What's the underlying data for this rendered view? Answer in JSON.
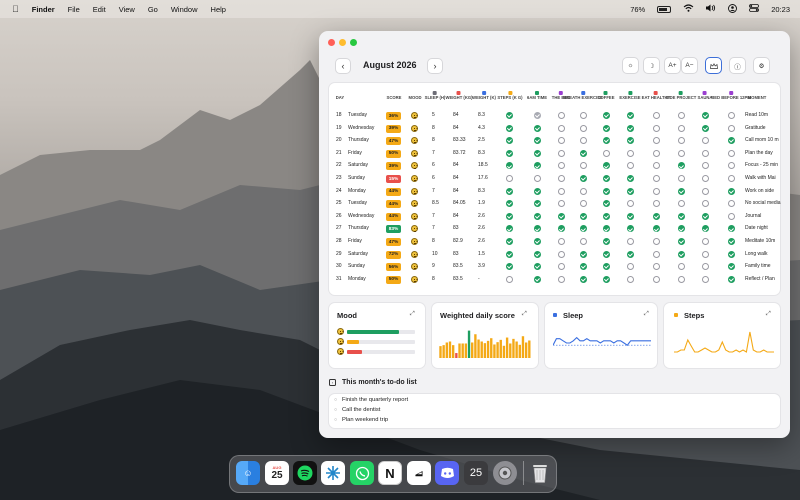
{
  "menubar": {
    "app_name": "Finder",
    "menus": [
      "File",
      "Edit",
      "View",
      "Go",
      "Window",
      "Help"
    ],
    "battery": "76%",
    "clock": "20:23"
  },
  "header": {
    "month": "August 2026",
    "prev_icon": "chevron-left-icon",
    "next_icon": "chevron-right-icon",
    "buttons": [
      "sun-icon",
      "moon-icon",
      "A+",
      "A−",
      "crown-icon",
      "info-icon",
      "gear-icon"
    ]
  },
  "columns": {
    "day": "DAY",
    "score": "SCORE",
    "mood": "MOOD",
    "sleep": "SLEEP (H)",
    "weight_kg": "WEIGHT (KG)",
    "weight_change": "WEIGHT (K)",
    "steps": "STEPS (K G)",
    "habits": [
      "6AM TIME",
      "THE BED",
      "BREATH EXERCISE",
      "COFFEE",
      "EXERCISE",
      "EAT HEALTHY",
      "SIDE PROJECT",
      "SAUNA",
      "BED BEFORE 12PM"
    ],
    "moment": "MOMENT"
  },
  "colors": {
    "sleep_dot": "#6c6c75",
    "weight_dot": "#e8504b",
    "weight2_dot": "#3a6fe0",
    "steps_dot": "#f4a916",
    "habit_dots": [
      "#1e9e60",
      "#9a3fd0",
      "#3a6fe0",
      "#1e9e60",
      "#1e9e60",
      "#e8504b",
      "#1e9e60",
      "#9a3fd0",
      "#9a3fd0"
    ],
    "score_high": "#f4b740",
    "score_mid": "#f0c33c",
    "score_low": "#e8504b",
    "score_top": "#1e9e60"
  },
  "rows": [
    {
      "day": "18",
      "weekday": "Tuesday",
      "score": "36%",
      "score_color": "#f4a916",
      "sleep": "5",
      "weight": "84",
      "delta": "8.3",
      "steps": "on",
      "habits": [
        "gray",
        "off",
        "off",
        "on",
        "on",
        "off",
        "off",
        "on",
        "off"
      ],
      "moment": "Read 10m"
    },
    {
      "day": "19",
      "weekday": "Wednesday",
      "score": "39%",
      "score_color": "#f4a916",
      "sleep": "8",
      "weight": "84",
      "delta": "4.3",
      "steps": "on",
      "habits": [
        "on",
        "off",
        "off",
        "on",
        "on",
        "off",
        "off",
        "on",
        "off"
      ],
      "moment": "Gratitude"
    },
    {
      "day": "20",
      "weekday": "Thursday",
      "score": "47%",
      "score_color": "#f4a916",
      "sleep": "8",
      "weight": "83.33",
      "delta": "2.5",
      "steps": "on",
      "habits": [
        "on",
        "off",
        "off",
        "on",
        "on",
        "off",
        "off",
        "off",
        "on"
      ],
      "moment": "Call mom 10 m"
    },
    {
      "day": "21",
      "weekday": "Friday",
      "score": "50%",
      "score_color": "#f4a916",
      "sleep": "7",
      "weight": "83.72",
      "delta": "8.3",
      "steps": "on",
      "habits": [
        "on",
        "off",
        "on",
        "off",
        "off",
        "off",
        "off",
        "off",
        "off"
      ],
      "moment": "Plan the day"
    },
    {
      "day": "22",
      "weekday": "Saturday",
      "score": "39%",
      "score_color": "#f4a916",
      "sleep": "6",
      "weight": "84",
      "delta": "18.5",
      "steps": "on",
      "habits": [
        "on",
        "off",
        "off",
        "on",
        "off",
        "off",
        "on",
        "off",
        "off"
      ],
      "moment": "Focus - 25 min"
    },
    {
      "day": "23",
      "weekday": "Sunday",
      "score": "15%",
      "score_color": "#e8504b",
      "sleep": "6",
      "weight": "84",
      "delta": "17.6",
      "steps": "off",
      "habits": [
        "off",
        "off",
        "on",
        "on",
        "on",
        "off",
        "off",
        "off",
        "off"
      ],
      "moment": "Walk with Mai"
    },
    {
      "day": "24",
      "weekday": "Monday",
      "score": "44%",
      "score_color": "#f4a916",
      "sleep": "7",
      "weight": "84",
      "delta": "8.3",
      "steps": "on",
      "habits": [
        "on",
        "off",
        "off",
        "on",
        "on",
        "off",
        "on",
        "off",
        "on"
      ],
      "moment": "Work on side"
    },
    {
      "day": "25",
      "weekday": "Tuesday",
      "score": "44%",
      "score_color": "#f4a916",
      "sleep": "8.5",
      "weight": "84.05",
      "delta": "1.9",
      "steps": "on",
      "habits": [
        "on",
        "off",
        "off",
        "on",
        "off",
        "off",
        "off",
        "off",
        "off"
      ],
      "moment": "No social media"
    },
    {
      "day": "26",
      "weekday": "Wednesday",
      "score": "44%",
      "score_color": "#f4a916",
      "sleep": "7",
      "weight": "84",
      "delta": "2.6",
      "steps": "on",
      "habits": [
        "on",
        "on",
        "on",
        "on",
        "on",
        "on",
        "on",
        "on",
        "off"
      ],
      "moment": "Journal"
    },
    {
      "day": "27",
      "weekday": "Thursday",
      "score": "83%",
      "score_color": "#1e9e60",
      "sleep": "7",
      "weight": "83",
      "delta": "2.6",
      "steps": "on",
      "habits": [
        "on",
        "on",
        "on",
        "on",
        "on",
        "on",
        "on",
        "on",
        "on"
      ],
      "moment": "Date night"
    },
    {
      "day": "28",
      "weekday": "Friday",
      "score": "47%",
      "score_color": "#f4a916",
      "sleep": "8",
      "weight": "82.9",
      "delta": "2.6",
      "steps": "on",
      "habits": [
        "on",
        "off",
        "off",
        "on",
        "off",
        "off",
        "on",
        "off",
        "on"
      ],
      "moment": "Meditate 10m"
    },
    {
      "day": "29",
      "weekday": "Saturday",
      "score": "72%",
      "score_color": "#f4a916",
      "sleep": "10",
      "weight": "83",
      "delta": "1.5",
      "steps": "on",
      "habits": [
        "on",
        "off",
        "on",
        "on",
        "on",
        "off",
        "on",
        "off",
        "on"
      ],
      "moment": "Long walk"
    },
    {
      "day": "30",
      "weekday": "Sunday",
      "score": "56%",
      "score_color": "#f4a916",
      "sleep": "9",
      "weight": "83.5",
      "delta": "3.9",
      "steps": "on",
      "habits": [
        "on",
        "off",
        "on",
        "on",
        "off",
        "off",
        "off",
        "off",
        "on"
      ],
      "moment": "Family time"
    },
    {
      "day": "31",
      "weekday": "Monday",
      "score": "50%",
      "score_color": "#f4a916",
      "sleep": "8",
      "weight": "83.5",
      "delta": "-",
      "steps": "off",
      "habits": [
        "on",
        "off",
        "on",
        "on",
        "off",
        "off",
        "off",
        "off",
        "on"
      ],
      "moment": "Reflect / Plan"
    }
  ],
  "widgets": {
    "mood": {
      "title": "Mood",
      "bars": [
        {
          "fraction": 0.77,
          "color": "#1e9e60"
        },
        {
          "fraction": 0.18,
          "color": "#f4a916"
        },
        {
          "fraction": 0.22,
          "color": "#e8504b"
        }
      ]
    },
    "score": {
      "title": "Weighted daily score",
      "color": "#f4a916",
      "highlight": "#1e9e60",
      "values": [
        0.36,
        0.39,
        0.47,
        0.5,
        0.39,
        0.15,
        0.44,
        0.44,
        0.44,
        0.83,
        0.47,
        0.72,
        0.56,
        0.5,
        0.45,
        0.52,
        0.6,
        0.41,
        0.48,
        0.55,
        0.37,
        0.62,
        0.44,
        0.58,
        0.5,
        0.4,
        0.66,
        0.47,
        0.53
      ]
    },
    "sleep": {
      "title": "Sleep",
      "color": "#3a6fe0",
      "dot": "#3a6fe0",
      "values": [
        5,
        8,
        8,
        7,
        6,
        6,
        7,
        8.5,
        7,
        7,
        8,
        7,
        7,
        7,
        6,
        7,
        7,
        7,
        6,
        7,
        7,
        6,
        5,
        7,
        7,
        7,
        7,
        7,
        7,
        7
      ]
    },
    "steps": {
      "title": "Steps",
      "color": "#f4a916",
      "dot": "#f4a916",
      "values": [
        2,
        2,
        3,
        3,
        8,
        5,
        2,
        2,
        3,
        4,
        3,
        2,
        2,
        3,
        7,
        3,
        2,
        2,
        3,
        2,
        3,
        2,
        12,
        3,
        2,
        2,
        3,
        2,
        2,
        2
      ]
    }
  },
  "todo": {
    "title": "This month's to-do list",
    "items": [
      "Finish the quarterly report",
      "Call the dentist",
      "Plan weekend trip"
    ]
  },
  "dock": {
    "calendar_month": "AUG",
    "calendar_day": "25",
    "tray_day": "25",
    "apps": [
      "finder-icon",
      "calendar-icon",
      "spotify-icon",
      "perplexity-icon",
      "whatsapp-icon",
      "notion-icon",
      "capcut-icon",
      "discord-icon",
      "calendar-widget-icon",
      "settings-icon",
      "trash-icon"
    ]
  }
}
